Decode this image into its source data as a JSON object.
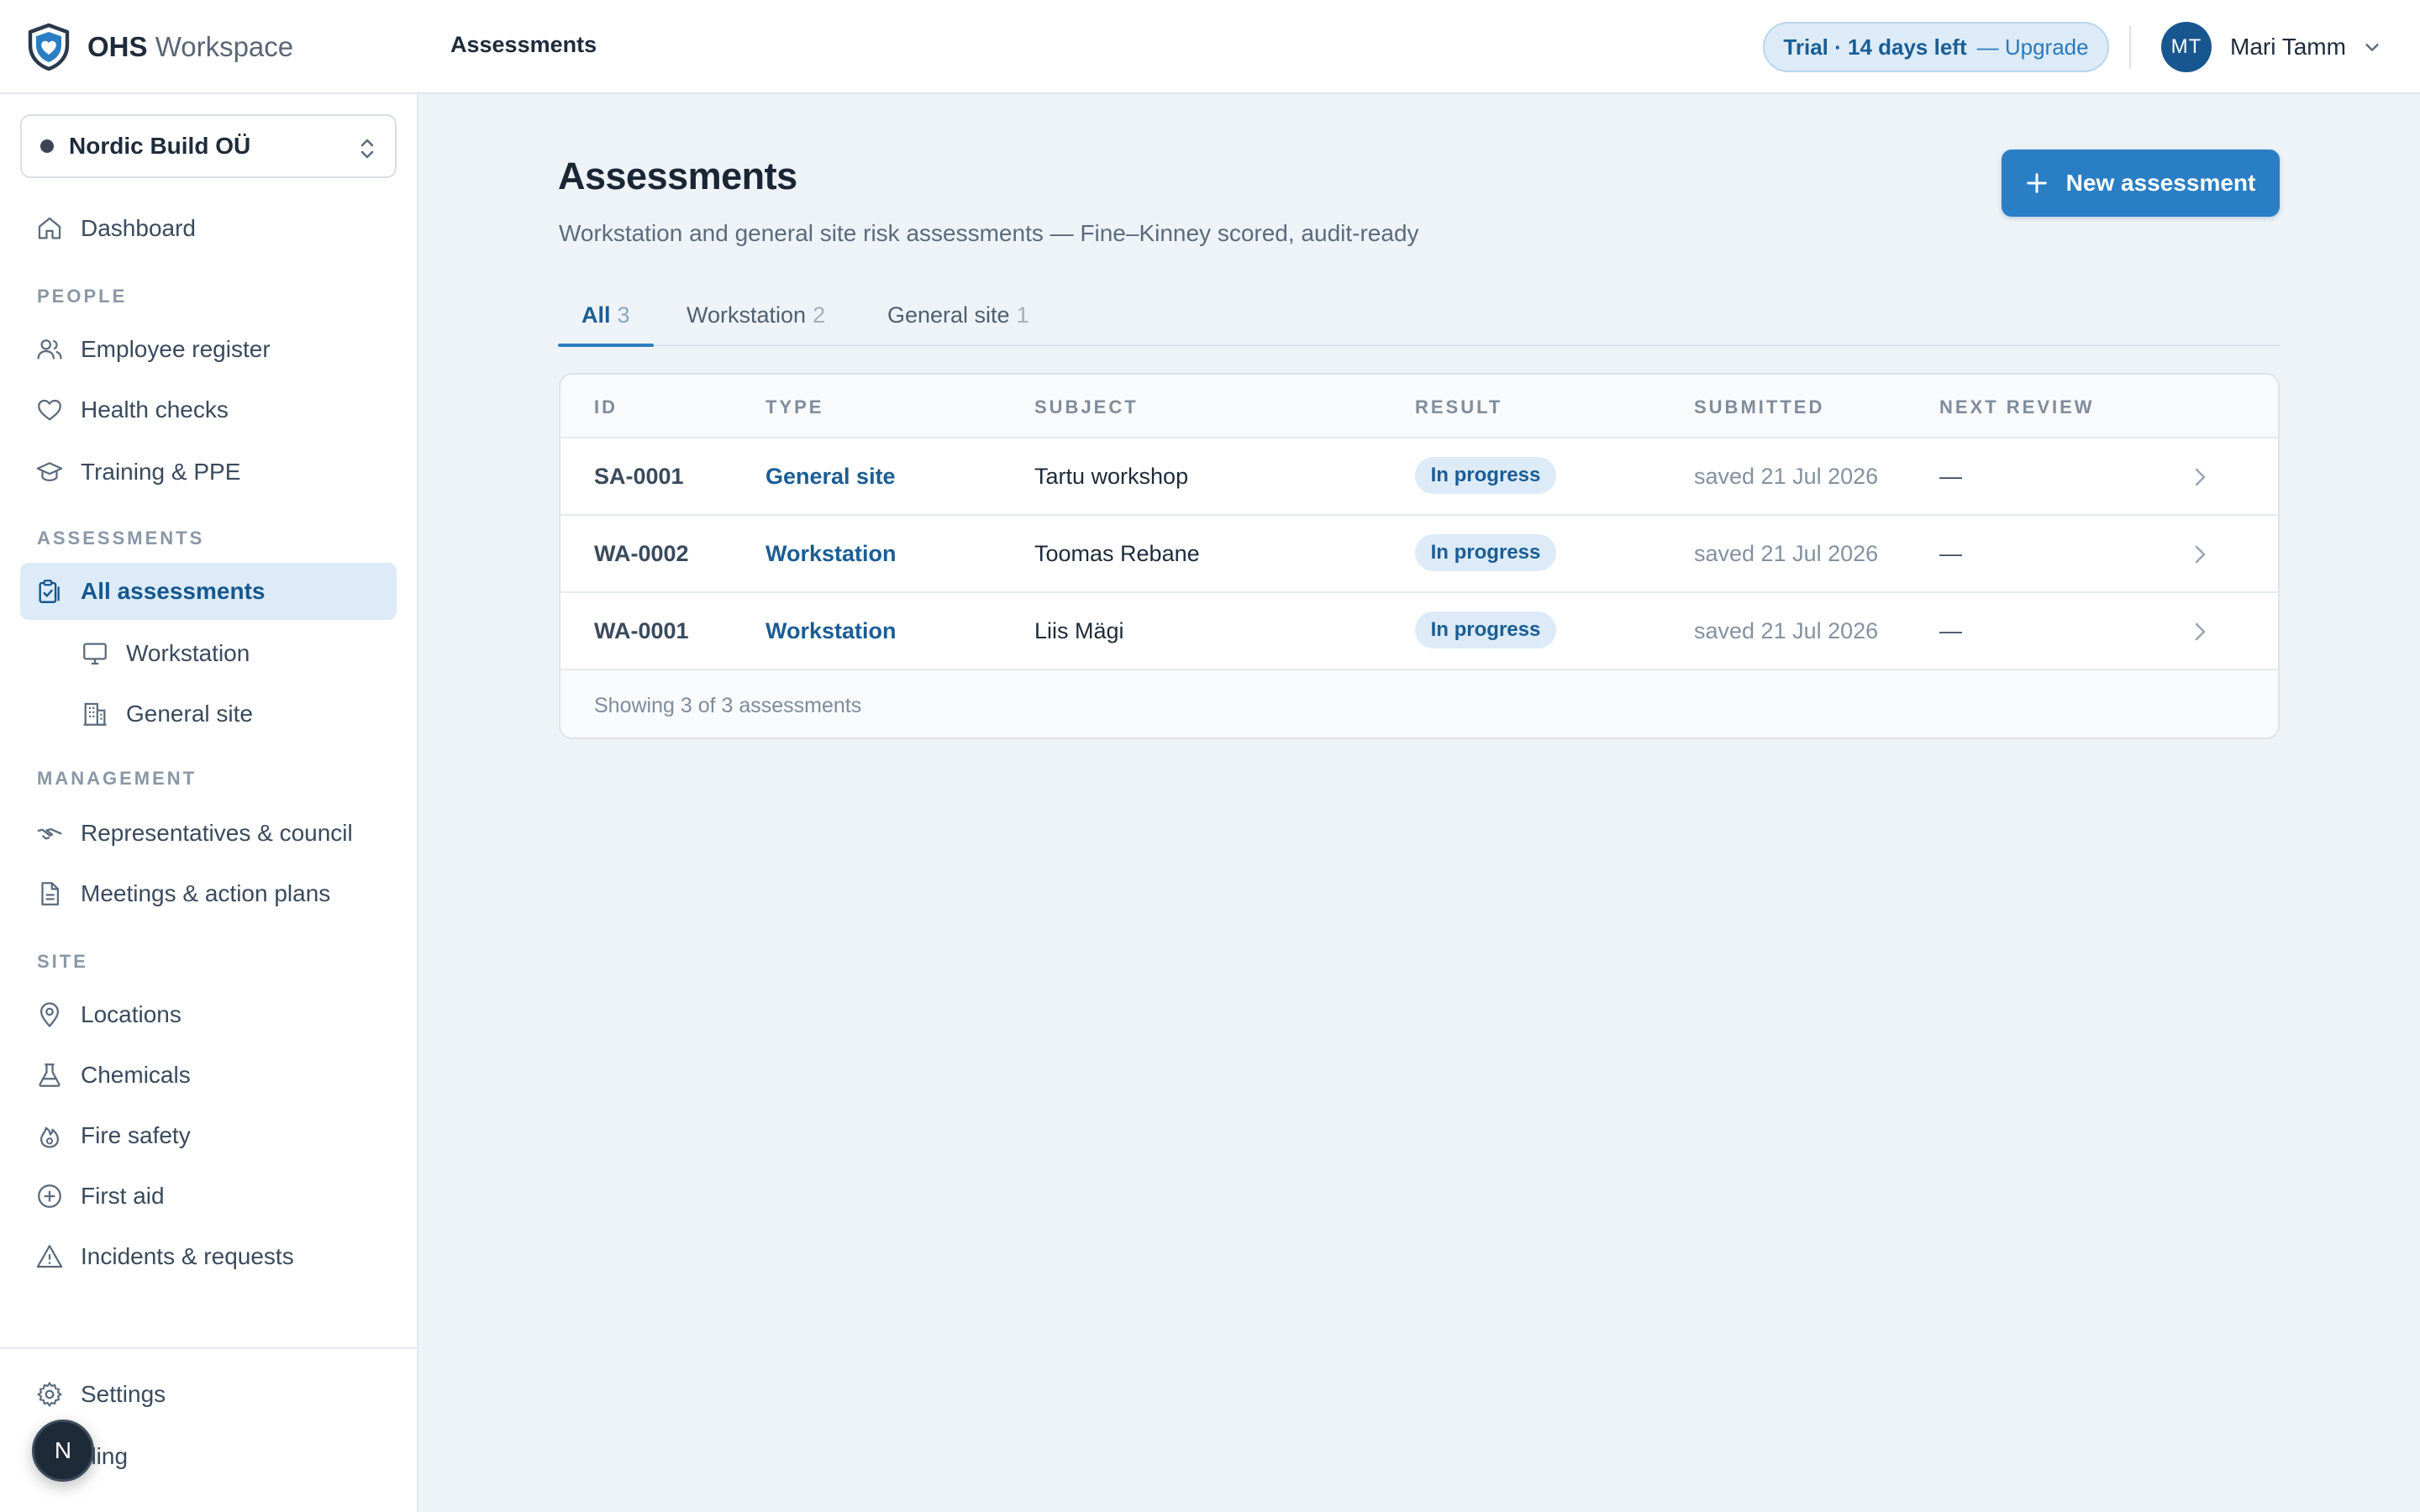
{
  "app": {
    "brand_bold": "OHS",
    "brand_rest": "Workspace",
    "page_heading": "Assessments"
  },
  "trial": {
    "status": "Trial · 14 days left",
    "upgrade": "— Upgrade"
  },
  "user": {
    "initials": "MT",
    "name": "Mari Tamm"
  },
  "sidebar": {
    "org_name": "Nordic Build OÜ",
    "dashboard": "Dashboard",
    "sections": {
      "people": "PEOPLE",
      "assessments": "ASSESSMENTS",
      "management": "MANAGEMENT",
      "site": "SITE"
    },
    "items": {
      "employee_register": "Employee register",
      "health_checks": "Health checks",
      "training_ppe": "Training & PPE",
      "all_assessments": "All assessments",
      "workstation": "Workstation",
      "general_site": "General site",
      "representatives": "Representatives & council",
      "meetings": "Meetings & action plans",
      "locations": "Locations",
      "chemicals": "Chemicals",
      "fire_safety": "Fire safety",
      "first_aid": "First aid",
      "incidents": "Incidents & requests",
      "settings": "Settings",
      "billing": "illing"
    },
    "fab_initial": "N"
  },
  "main": {
    "title": "Assessments",
    "subtitle": "Workstation and general site risk assessments — Fine–Kinney scored, audit-ready",
    "new_button": "New assessment",
    "tabs": [
      {
        "label": "All",
        "count": "3"
      },
      {
        "label": "Workstation",
        "count": "2"
      },
      {
        "label": "General site",
        "count": "1"
      }
    ],
    "table": {
      "headers": [
        "ID",
        "TYPE",
        "SUBJECT",
        "RESULT",
        "SUBMITTED",
        "NEXT REVIEW"
      ],
      "rows": [
        {
          "id": "SA-0001",
          "type": "General site",
          "subject": "Tartu workshop",
          "result": "In progress",
          "submitted": "saved 21 Jul 2026",
          "next_review": "—"
        },
        {
          "id": "WA-0002",
          "type": "Workstation",
          "subject": "Toomas Rebane",
          "result": "In progress",
          "submitted": "saved 21 Jul 2026",
          "next_review": "—"
        },
        {
          "id": "WA-0001",
          "type": "Workstation",
          "subject": "Liis Mägi",
          "result": "In progress",
          "submitted": "saved 21 Jul 2026",
          "next_review": "—"
        }
      ],
      "footer": "Showing 3 of 3 assessments"
    }
  },
  "colors": {
    "accent": "#2a7ec4",
    "accent_dark": "#1b5d94",
    "accent_soft": "#dcebf7",
    "page_bg": "#eef3f8"
  }
}
